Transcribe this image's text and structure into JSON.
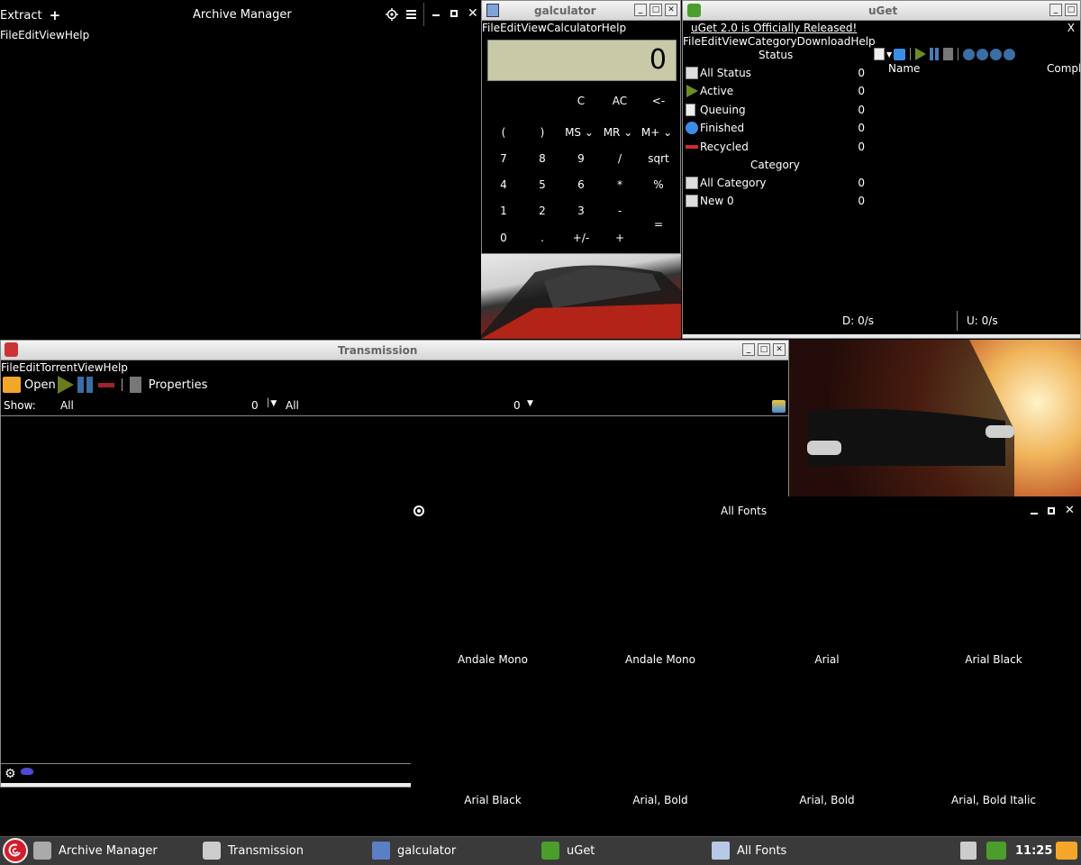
{
  "archive": {
    "extract_label": "Extract",
    "title": "Archive Manager",
    "menu": [
      "File",
      "Edit",
      "View",
      "Help"
    ]
  },
  "galculator": {
    "title": "galculator",
    "menu": [
      "File",
      "Edit",
      "View",
      "Calculator",
      "Help"
    ],
    "display": "0",
    "row1": [
      "C",
      "AC",
      "<-"
    ],
    "row2": [
      "(",
      ")",
      "MS",
      "MR",
      "M+"
    ],
    "row3": [
      "7",
      "8",
      "9",
      "/",
      "sqrt"
    ],
    "row4": [
      "4",
      "5",
      "6",
      "*",
      "%"
    ],
    "row5": [
      "1",
      "2",
      "3",
      "-",
      "="
    ],
    "row6": [
      "0",
      ".",
      "+/-",
      "+"
    ]
  },
  "uget": {
    "title": "uGet",
    "close": "X",
    "banner": "uGet 2.0 is Officially Released!",
    "menu": [
      "File",
      "Edit",
      "View",
      "Category",
      "Download",
      "Help"
    ],
    "status_header": "Status",
    "status": [
      {
        "label": "All Status",
        "count": "0",
        "icon": "all-status-icon"
      },
      {
        "label": "Active",
        "count": "0",
        "icon": "active-icon"
      },
      {
        "label": "Queuing",
        "count": "0",
        "icon": "queuing-icon"
      },
      {
        "label": "Finished",
        "count": "0",
        "icon": "finished-icon"
      },
      {
        "label": "Recycled",
        "count": "0",
        "icon": "recycled-icon"
      }
    ],
    "category_header": "Category",
    "categories": [
      {
        "label": "All Category",
        "count": "0"
      },
      {
        "label": "New 0",
        "count": "0"
      }
    ],
    "col_name": "Name",
    "col_complete": "Compl",
    "download_speed": "D: 0/s",
    "upload_speed": "U: 0/s"
  },
  "transmission": {
    "title": "Transmission",
    "menu": [
      "File",
      "Edit",
      "Torrent",
      "View",
      "Help"
    ],
    "open_label": "Open",
    "properties_label": "Properties",
    "show_label": "Show:",
    "filter1": "All",
    "filter1_count": "0",
    "filter2": "All",
    "filter2_count": "0"
  },
  "fonts": {
    "title": "All Fonts",
    "row1": [
      "Andale Mono",
      "Andale Mono",
      "Arial",
      "Arial Black"
    ],
    "row2": [
      "Arial Black",
      "Arial, Bold",
      "Arial, Bold",
      "Arial, Bold Italic"
    ]
  },
  "taskbar": {
    "items": [
      {
        "label": "Archive Manager"
      },
      {
        "label": "Transmission"
      },
      {
        "label": "galculator"
      },
      {
        "label": "uGet"
      },
      {
        "label": "All Fonts"
      }
    ],
    "clock": "11:25"
  },
  "colors": {
    "lcd": "#c8c9a6",
    "accent_green": "#6b8e23",
    "taskbar": "#3a3a3a"
  }
}
